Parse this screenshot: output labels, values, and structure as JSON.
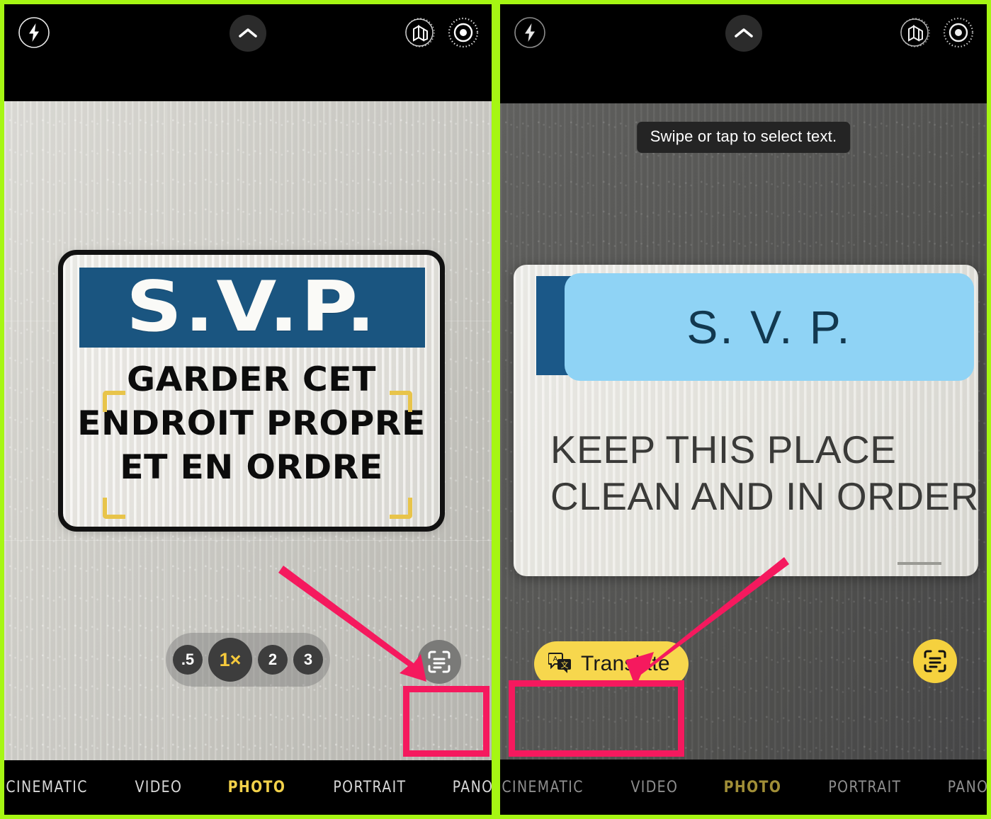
{
  "theme": {
    "accent_green": "#a6f613",
    "accent_pink": "#f5195e",
    "accent_yellow": "#f2d14a",
    "sign_blue": "#1a5580",
    "translate_blue": "#8fd3f5"
  },
  "left_panel": {
    "name": "Camera app with Live Text scan button highlighted",
    "topbar": {
      "flash_icon": "flash-icon",
      "chevron_icon": "chevron-up-icon",
      "live_photo_icon": "live-photo-icon",
      "photographic_styles_icon": "photographic-styles-icon"
    },
    "sign": {
      "banner_text": "S.V.P.",
      "body_lines": [
        "GARDER CET",
        "ENDROIT PROPRE",
        "ET EN ORDRE"
      ]
    },
    "zoom_controls": {
      "options": [
        {
          "label": ".5",
          "active": false
        },
        {
          "label": "1×",
          "active": true
        },
        {
          "label": "2",
          "active": false
        },
        {
          "label": "3",
          "active": false
        }
      ]
    },
    "scan_button": {
      "icon": "live-text-scan-icon",
      "active": false
    },
    "modes": [
      {
        "label": "CINEMATIC",
        "active": false
      },
      {
        "label": "VIDEO",
        "active": false
      },
      {
        "label": "PHOTO",
        "active": true
      },
      {
        "label": "PORTRAIT",
        "active": false
      },
      {
        "label": "PANO",
        "active": false
      }
    ]
  },
  "right_panel": {
    "name": "Camera app with Live Text active and Translate button highlighted",
    "topbar": {
      "flash_icon": "flash-icon",
      "chevron_icon": "chevron-up-icon",
      "live_photo_icon": "live-photo-icon",
      "photographic_styles_icon": "photographic-styles-icon"
    },
    "tooltip": "Swipe or tap to select text.",
    "sign": {
      "banner_translated_text": "S. V. P.",
      "body_lines": [
        "KEEP THIS PLACE",
        "CLEAN AND IN ORDER"
      ]
    },
    "translate_button": {
      "label": "Translate",
      "icon": "translate-icon"
    },
    "scan_button": {
      "icon": "live-text-scan-icon",
      "active": true
    },
    "modes": [
      {
        "label": "CINEMATIC",
        "active": false
      },
      {
        "label": "VIDEO",
        "active": false
      },
      {
        "label": "PHOTO",
        "active": true
      },
      {
        "label": "PORTRAIT",
        "active": false
      },
      {
        "label": "PANO",
        "active": false
      }
    ]
  }
}
